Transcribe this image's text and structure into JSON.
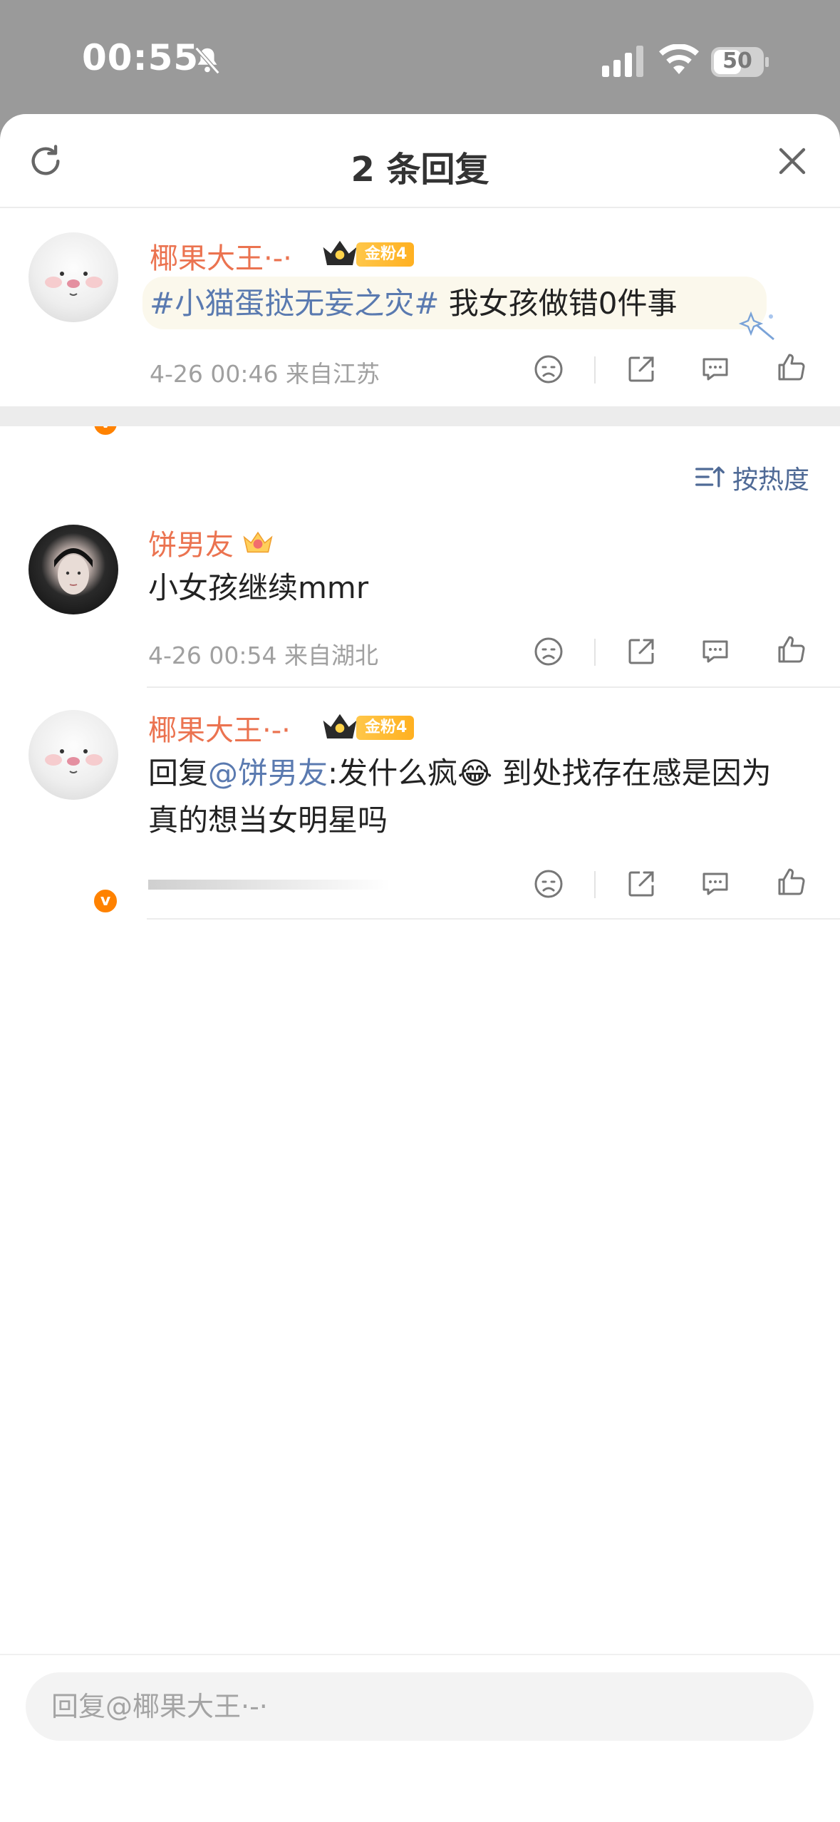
{
  "status_bar": {
    "time": "00:55",
    "battery": "50"
  },
  "header": {
    "title": "2 条回复"
  },
  "original_comment": {
    "username": "椰果大王·-·",
    "fan_badge": "金粉4",
    "topic": "#小猫蛋挞无妄之灾#",
    "text": " 我女孩做错0件事",
    "meta": "4-26 00:46 来自江苏"
  },
  "sort": {
    "label": "按热度"
  },
  "replies": [
    {
      "username": "饼男友",
      "text": "小女孩继续mmr",
      "meta": "4-26 00:54 来自湖北"
    },
    {
      "username": "椰果大王·-·",
      "fan_badge": "金粉4",
      "reply_prefix": "回复",
      "mention": "@饼男友",
      "text": ":发什么疯😂 到处找存在感是因为真的想当女明星吗",
      "meta": ""
    }
  ],
  "footer": {
    "placeholder": "回复@椰果大王·-·"
  },
  "colors": {
    "name": "#eb7350",
    "topic": "#5a7ab0",
    "verified": "#ff8200",
    "badge": "#ffb020"
  }
}
